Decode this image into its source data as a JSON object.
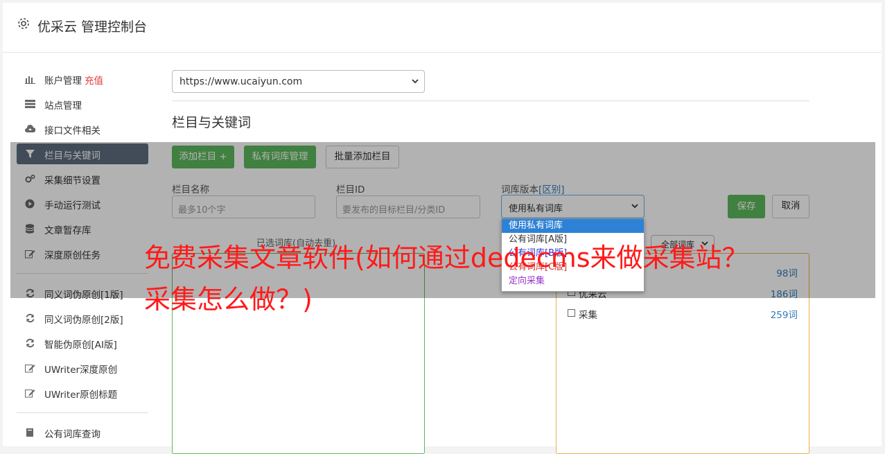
{
  "header": {
    "title": "优采云 管理控制台",
    "icon": "gear-icon"
  },
  "sidebar": {
    "items": [
      {
        "label": "账户管理",
        "badge": "充值",
        "icon": "bar-chart-icon"
      },
      {
        "label": "站点管理",
        "icon": "server-icon"
      },
      {
        "label": "接口文件相关",
        "icon": "cloud-upload-icon"
      },
      {
        "label": "栏目与关键词",
        "icon": "filter-icon"
      },
      {
        "label": "采集细节设置",
        "icon": "cogs-icon"
      },
      {
        "label": "手动运行测试",
        "icon": "play-circle-icon"
      },
      {
        "label": "文章暂存库",
        "icon": "database-icon"
      },
      {
        "label": "深度原创任务",
        "icon": "edit-icon"
      },
      {
        "label": "同义词伪原创[1版]",
        "icon": "refresh-icon"
      },
      {
        "label": "同义词伪原创[2版]",
        "icon": "refresh-icon"
      },
      {
        "label": "智能伪原创[AI版]",
        "icon": "refresh-icon"
      },
      {
        "label": "UWriter深度原创",
        "icon": "edit-icon"
      },
      {
        "label": "UWriter原创标题",
        "icon": "edit-icon"
      },
      {
        "label": "公有词库查询",
        "icon": "book-icon"
      }
    ]
  },
  "main": {
    "site_select": "https://www.ucaiyun.com",
    "section_title": "栏目与关键词",
    "buttons": {
      "add_column": "添加栏目 +",
      "private_lib": "私有词库管理",
      "batch_add": "批量添加栏目",
      "save": "保存",
      "cancel": "取消"
    },
    "fields": {
      "name_label": "栏目名称",
      "name_placeholder": "最多10个字",
      "id_label": "栏目ID",
      "id_placeholder": "要发布的目标栏目/分类ID",
      "version_label": "词库版本",
      "version_link": "[区别]",
      "version_value": "使用私有词库"
    },
    "dropdown_options": [
      {
        "label": "使用私有词库",
        "color": "#ffffff"
      },
      {
        "label": "公有词库[A版]",
        "color": "#333333"
      },
      {
        "label": "公有词库[B版]",
        "color": "#3333cc"
      },
      {
        "label": "公有词库[C版]",
        "color": "#cc3333"
      },
      {
        "label": "定向采集",
        "color": "#9933cc"
      }
    ],
    "selected_hint": "已选词库(自动去重)",
    "filter_select": "全部词库",
    "wordlists": [
      {
        "name": "",
        "count": "98词"
      },
      {
        "name": "优采云",
        "count": "186词"
      },
      {
        "name": "采集",
        "count": "259词"
      }
    ]
  },
  "overlay_caption": "免费采集文章软件(如何通过dedecms来做采集站？采集怎么做？)",
  "colors": {
    "accent_green": "#5cb85c",
    "link_blue": "#337ab7",
    "caption_red": "#ff1a1a",
    "active_nav": "#5d6d7e"
  }
}
